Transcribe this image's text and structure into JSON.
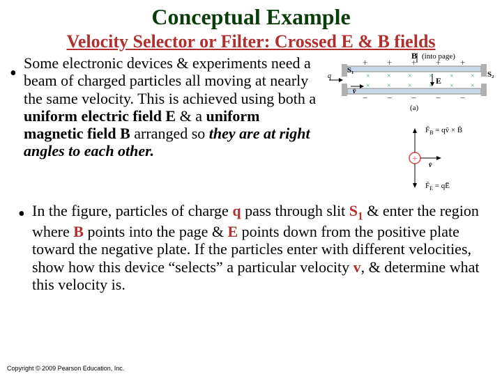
{
  "title": "Conceptual Example",
  "subtitle": "Velocity Selector or Filter: Crossed E & B fields",
  "p1": {
    "a": "Some electronic devices & experiments need a beam of charged particles all moving at nearly the same velocity. This is achieved using both a ",
    "b": "uniform electric field E",
    "c": " & a ",
    "d": "uniform magnetic field B",
    "e": " arranged so ",
    "f": "they are at right angles to each  other."
  },
  "p2": {
    "a": "In the figure, particles of charge ",
    "b": "q",
    "c": " pass through slit ",
    "d": "S",
    "d1": "1",
    "e": " & enter the region where ",
    "f": "B",
    "g": " points into the page & ",
    "h": "E",
    "i": " points down from the positive plate toward the negative plate. If the particles enter with different velocities, show how this device “selects” a particular velocity ",
    "j": "v",
    "k": ", & determine what this velocity is."
  },
  "fig": {
    "B": "B",
    "Binto": "(into page)",
    "S1": "S1",
    "S2": "S2",
    "E": "E",
    "v": "v",
    "q": "q",
    "a": "(a)",
    "FB": "F̅B = qv̄ × B̅",
    "FE": "F̅E = qE̅"
  },
  "footer": "Copyright © 2009 Pearson Education, Inc."
}
